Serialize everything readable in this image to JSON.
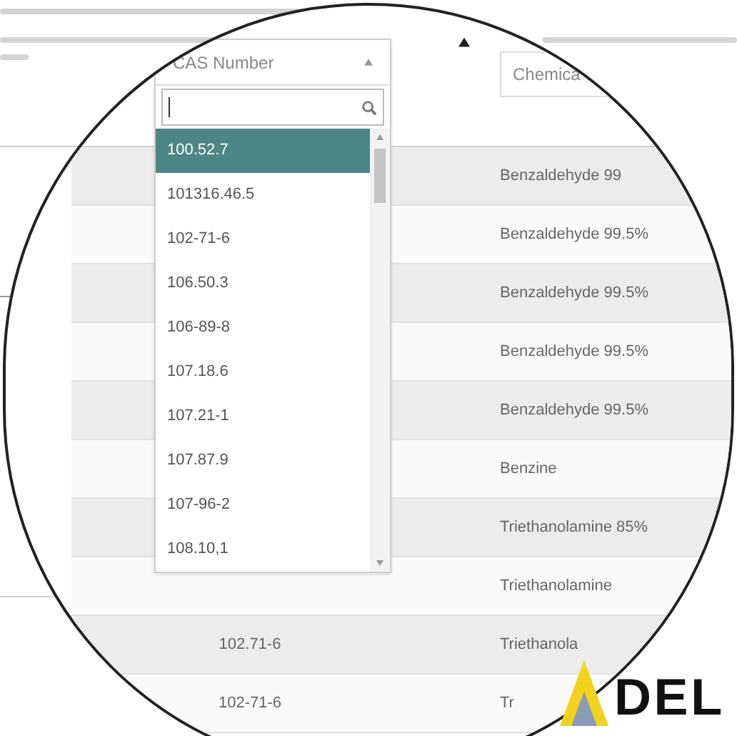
{
  "dropdown": {
    "title": "CAS Number",
    "options": [
      {
        "label": "100.52.7",
        "selected": true
      },
      {
        "label": "101316.46.5",
        "selected": false
      },
      {
        "label": "102-71-6",
        "selected": false
      },
      {
        "label": "106.50.3",
        "selected": false
      },
      {
        "label": "106-89-8",
        "selected": false
      },
      {
        "label": "107.18.6",
        "selected": false
      },
      {
        "label": "107.21-1",
        "selected": false
      },
      {
        "label": "107.87.9",
        "selected": false
      },
      {
        "label": "107-96-2",
        "selected": false
      },
      {
        "label": "108.10,1",
        "selected": false
      }
    ]
  },
  "table": {
    "columns": [
      {
        "label": "Chemica"
      }
    ],
    "rows": [
      {
        "chemical": "Benzaldehyde 99"
      },
      {
        "chemical": "Benzaldehyde 99.5%"
      },
      {
        "chemical": "Benzaldehyde 99.5%"
      },
      {
        "chemical": "Benzaldehyde 99.5%"
      },
      {
        "chemical": "Benzaldehyde 99.5%"
      },
      {
        "chemical": "Benzine"
      },
      {
        "chemical": "Triethanolamine 85%"
      },
      {
        "chemical": "Triethanolamine"
      },
      {
        "cas": "102.71-6",
        "chemical": "Triethanola"
      },
      {
        "cas": "102-71-6",
        "chemical": "Tr"
      }
    ]
  },
  "logo": {
    "text": "DEL"
  }
}
